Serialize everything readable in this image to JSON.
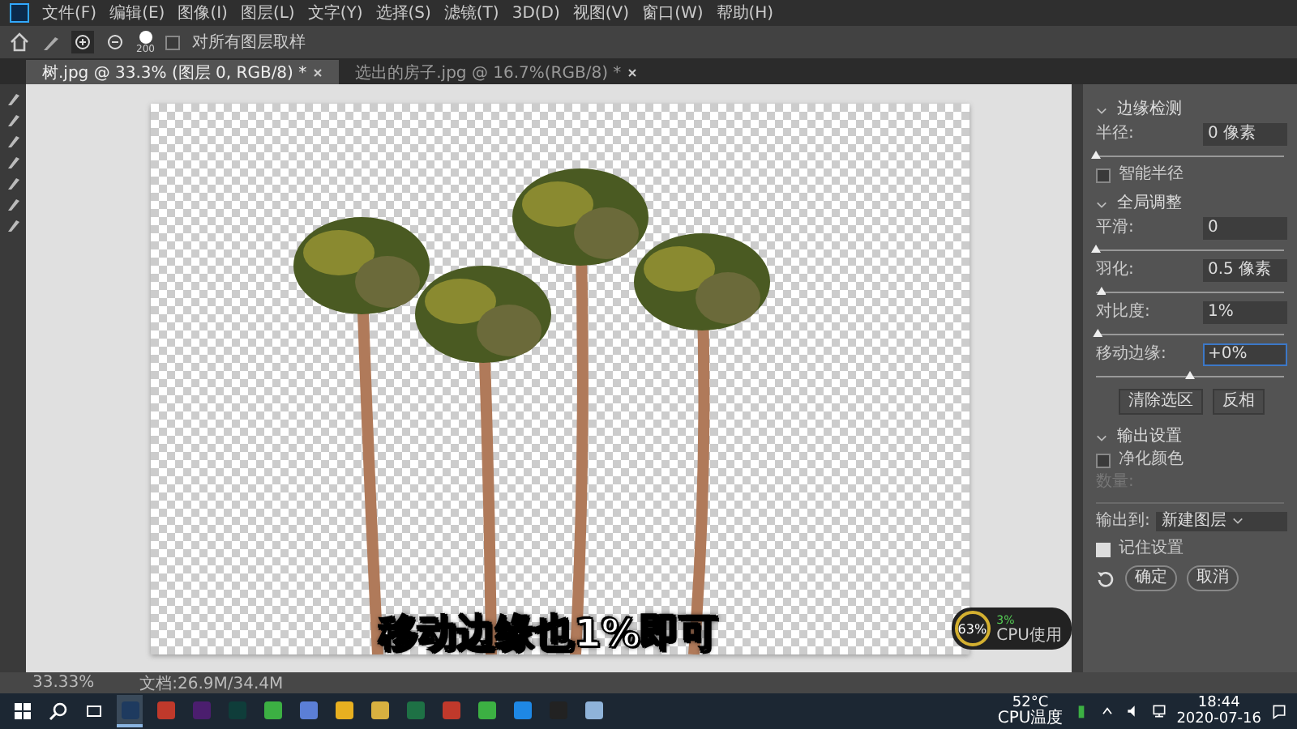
{
  "menu_bar": {
    "items": [
      "文件(F)",
      "编辑(E)",
      "图像(I)",
      "图层(L)",
      "文字(Y)",
      "选择(S)",
      "滤镜(T)",
      "3D(D)",
      "视图(V)",
      "窗口(W)",
      "帮助(H)"
    ]
  },
  "options_bar": {
    "brush_size": "200",
    "sample_all": {
      "label": "对所有图层取样",
      "checked": false
    }
  },
  "tabs": [
    {
      "label": "树.jpg @ 33.3% (图层 0, RGB/8) *",
      "selected": true
    },
    {
      "label": "选出的房子.jpg @ 16.7%(RGB/8) *",
      "selected": false
    }
  ],
  "subtitle": "移动边缘也1%即可",
  "cpu_widget": {
    "usage": "63%",
    "secondary": "3%",
    "label": "CPU使用"
  },
  "properties_panel": {
    "sections": [
      {
        "title": "边缘检测",
        "rows": [
          {
            "kind": "slider",
            "label": "半径:",
            "value": "0 像素",
            "level": 0
          },
          {
            "kind": "checkbox",
            "label": "智能半径",
            "checked": false
          }
        ]
      },
      {
        "title": "全局调整",
        "rows": [
          {
            "kind": "slider",
            "label": "平滑:",
            "value": "0",
            "level": 0
          },
          {
            "kind": "slider",
            "label": "羽化:",
            "value": "0.5 像素",
            "level": 0.03
          },
          {
            "kind": "slider",
            "label": "对比度:",
            "value": "1%",
            "level": 0.01
          },
          {
            "kind": "slider",
            "label": "移动边缘:",
            "value": "+0%",
            "level": 0.5,
            "focused": true
          },
          {
            "kind": "buttons",
            "buttons": [
              "清除选区",
              "反相"
            ]
          }
        ]
      },
      {
        "title": "输出设置",
        "rows": [
          {
            "kind": "checkbox",
            "label": "净化颜色",
            "checked": false
          },
          {
            "kind": "slider",
            "label": "数量:",
            "disabled": true
          },
          {
            "kind": "dropdown",
            "label": "输出到:",
            "value": "新建图层"
          }
        ]
      }
    ],
    "remember": {
      "label": "记住设置",
      "checked": true
    },
    "buttons": [
      "确定",
      "取消"
    ]
  },
  "status_bar": {
    "zoom": "33.33%",
    "document": "文档:26.9M/34.4M"
  },
  "taskbar": {
    "apps": [
      {
        "selected": true,
        "color": "#1e3a5f"
      },
      {
        "selected": false,
        "color": "#c0392b"
      },
      {
        "selected": false,
        "color": "#4b1e6e"
      },
      {
        "selected": false,
        "color": "#0f3d3a"
      },
      {
        "selected": false,
        "color": "#3cb043"
      },
      {
        "selected": false,
        "color": "#5b7fd6"
      },
      {
        "selected": false,
        "color": "#e8b020"
      },
      {
        "selected": false,
        "color": "#d8b040"
      },
      {
        "selected": false,
        "color": "#1e7145"
      },
      {
        "selected": false,
        "color": "#c0392b"
      },
      {
        "selected": false,
        "color": "#3cb043"
      },
      {
        "selected": false,
        "color": "#1e88e5"
      },
      {
        "selected": false,
        "color": "#222222"
      },
      {
        "selected": false,
        "color": "#8fb3d9"
      }
    ],
    "temperature": "52°C",
    "temperature_label": "CPU温度",
    "time": "18:44",
    "date": "2020-07-16"
  }
}
